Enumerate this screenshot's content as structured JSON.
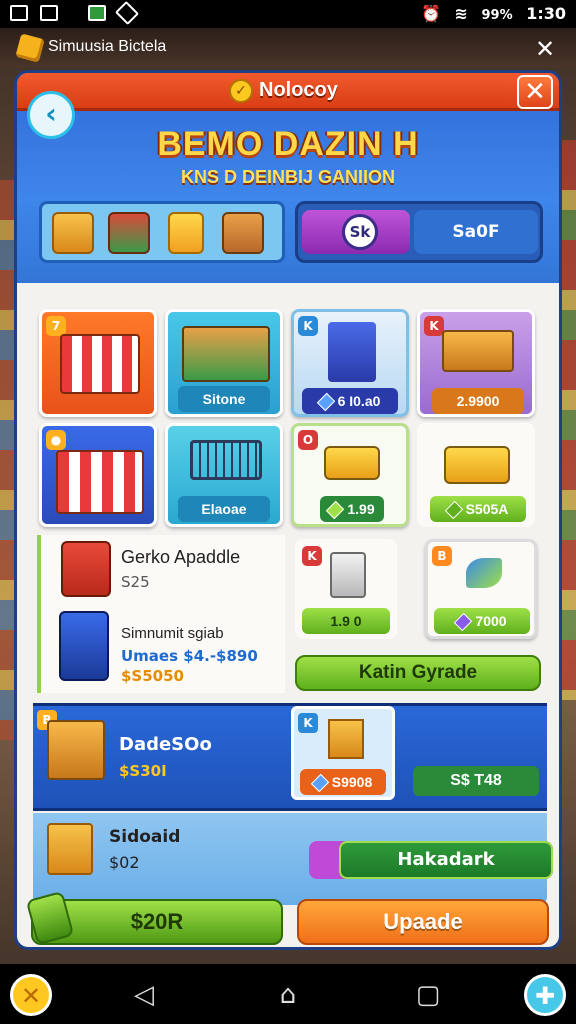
{
  "status_bar": {
    "battery": "99%",
    "time": "1:30"
  },
  "app": {
    "title": "Simuusia Bictela"
  },
  "panel": {
    "title": "Nolocoy",
    "headline": "BEMO DAZIN H",
    "subheadline": "KNS D DEINBIJ GANIION",
    "toggle_knob": "Sk",
    "toggle_label": "Sa0F"
  },
  "tiles": {
    "store_badge_label": "Sitone",
    "cart_label": "Elaoae",
    "server_price": "6 I0.a0",
    "boxes_price": "2.9900",
    "truck_price": "1.99",
    "van_price": "S505A",
    "machine_price": "1.9 0",
    "gem_price": "7000"
  },
  "list": {
    "item1_title": "Gerko Apaddle",
    "item1_sub": "S25",
    "item2_title": "Simnumit sgiab",
    "item2_line1": "Umaes $4.-$890",
    "item2_line2": "$S5050",
    "btn": "Katin Gyrade"
  },
  "banner1": {
    "title": "DadeSOo",
    "price": "$S30I",
    "box_price": "S9908",
    "green_price": "S$ T48"
  },
  "banner2": {
    "title": "Sidoaid",
    "value": "$02",
    "progress_label": "Hakadark"
  },
  "buttons": {
    "left": "$20R",
    "right": "Upaade"
  },
  "colors": {
    "accent_orange": "#f25a2c",
    "accent_green": "#6fbf24",
    "panel_blue": "#2f6ad8"
  }
}
